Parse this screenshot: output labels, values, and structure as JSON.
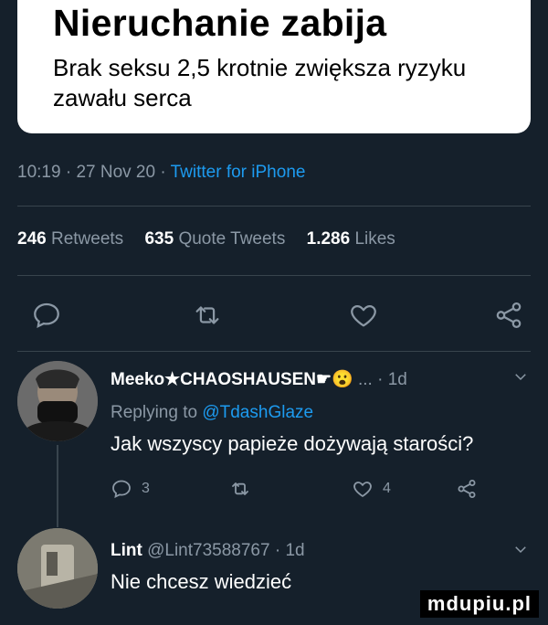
{
  "headline": {
    "title": "Nieruchanie zabija",
    "subtitle": "Brak seksu 2,5 krotnie zwiększa ryzyku zawału serca"
  },
  "tweet_meta": {
    "time": "10:19",
    "date": "27 Nov 20",
    "source": "Twitter for iPhone",
    "sep": "·"
  },
  "stats": {
    "retweets_count": "246",
    "retweets_label": "Retweets",
    "quotes_count": "635",
    "quotes_label": "Quote Tweets",
    "likes_count": "1.286",
    "likes_label": "Likes"
  },
  "replies": [
    {
      "name": "Meeko★CHAOSHAUSEN☛😮",
      "handle": "...",
      "time": "· 1d",
      "replying_prefix": "Replying to",
      "replying_to": "@TdashGlaze",
      "text": "Jak wszyscy papieże dożywają starości?",
      "reply_count": "3",
      "like_count": "4"
    },
    {
      "name": "Lint",
      "handle": "@Lint73588767",
      "time": "· 1d",
      "text": "Nie chcesz wiedzieć"
    }
  ],
  "watermark": "mdupiu.pl",
  "colors": {
    "background": "#15202b",
    "link": "#1d9bf0",
    "muted": "#8b98a5"
  }
}
